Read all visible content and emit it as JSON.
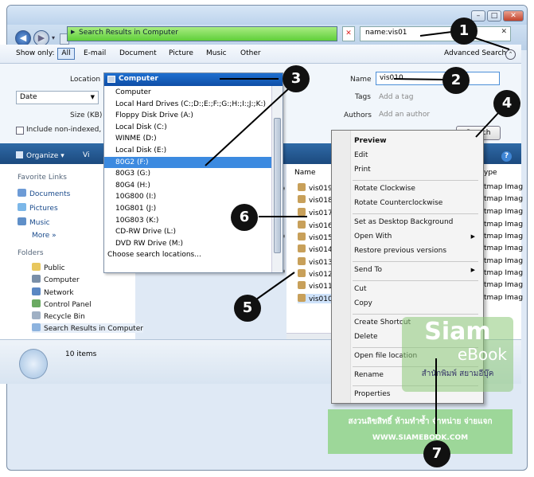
{
  "address": {
    "path": "Search Results in Computer"
  },
  "search": {
    "value": "name:vis01"
  },
  "show_only": {
    "label": "Show only:",
    "items": [
      "All",
      "E-mail",
      "Document",
      "Picture",
      "Music",
      "Other"
    ],
    "advanced": "Advanced Search"
  },
  "advanced": {
    "location_label": "Location",
    "location_value": "Computer",
    "date_value": "Date",
    "size_label": "Size (KB)",
    "include_label": "Include non-indexed, h",
    "name_label": "Name",
    "name_value": "vis010",
    "tags_label": "Tags",
    "tags_placeholder": "Add a tag",
    "authors_label": "Authors",
    "authors_placeholder": "Add an author",
    "search_btn": "Search"
  },
  "toolbar": {
    "organize": "Organize",
    "views": "Vi"
  },
  "nav": {
    "favorite_links": "Favorite Links",
    "links": [
      "Documents",
      "Pictures",
      "Music"
    ],
    "more": "More",
    "folders": "Folders",
    "tree": [
      "Public",
      "Computer",
      "Network",
      "Control Panel",
      "Recycle Bin",
      "Search Results in Computer"
    ]
  },
  "dropdown": {
    "header": "Computer",
    "items": [
      "Computer",
      "Local Hard Drives (C:;D:;E:;F:;G:;H:;I:;J:;K:)",
      "Floppy Disk Drive (A:)",
      "Local Disk (C:)",
      "WINME (D:)",
      "Local Disk (E:)",
      "80G2 (F:)",
      "80G3 (G:)",
      "80G4 (H:)",
      "10G800 (I:)",
      "10G801 (J:)",
      "10G803 (K:)",
      "CD-RW Drive (L:)",
      "DVD RW Drive (M:)",
      "Choose search locations..."
    ],
    "selected_index": 6
  },
  "filelist": {
    "col_name": "Name",
    "col_type": "ype",
    "files": [
      "vis019",
      "vis018",
      "vis017",
      "vis016",
      "vis015",
      "vis014",
      "vis013",
      "vis012",
      "vis011",
      "vis010"
    ],
    "type": "tmap Imag"
  },
  "details": {
    "count": "10 items"
  },
  "context_menu": {
    "items": [
      "Preview",
      "Edit",
      "Print",
      "Rotate Clockwise",
      "Rotate Counterclockwise",
      "Set as Desktop Background",
      "Open With",
      "Restore previous versions",
      "Send To",
      "Cut",
      "Copy",
      "Create Shortcut",
      "Delete",
      "Open file location",
      "Rename",
      "Properties"
    ]
  },
  "callouts": [
    "1",
    "2",
    "3",
    "4",
    "5",
    "6",
    "7"
  ],
  "watermark": {
    "brand": "Siam",
    "sub": "eBook",
    "thai": "สำนักพิมพ์ สยามอีบุ๊ค",
    "banner_line1": "สงวนลิขสิทธิ์ ห้ามทำซ้ำ จำหน่าย จ่ายแจก",
    "banner_line2": "WWW.SIAMEBOOK.COM"
  },
  "colors": {
    "accent": "#1d6fd0",
    "address_green": "#5fcf3a",
    "toolbar": "#1c4a7f"
  }
}
